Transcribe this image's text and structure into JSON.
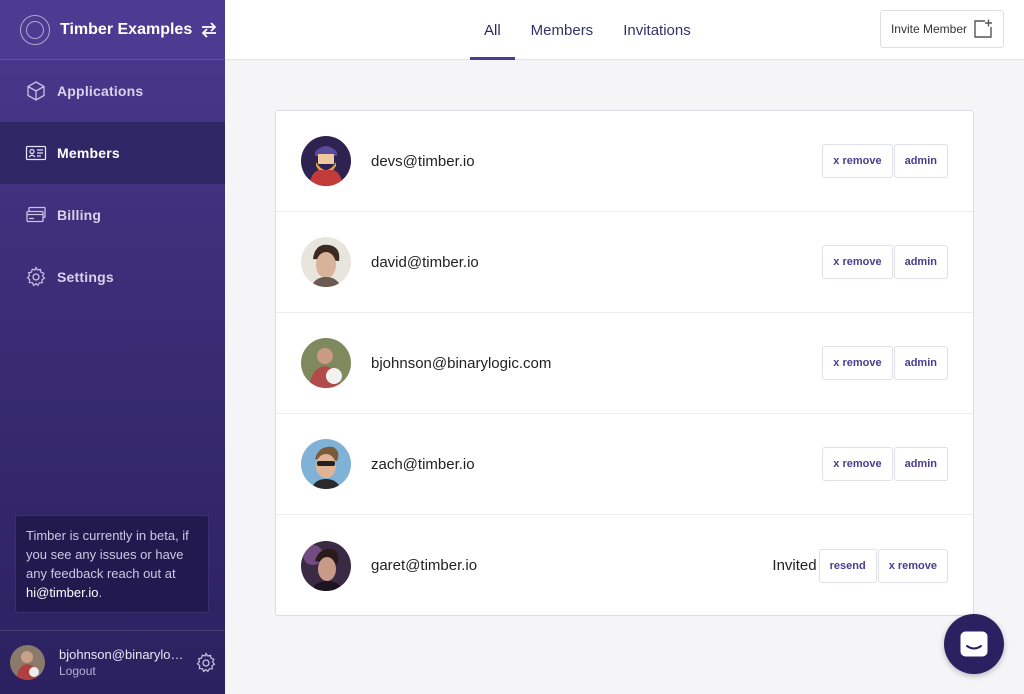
{
  "app": {
    "title": "Timber Examples"
  },
  "sidebar": {
    "items": [
      {
        "label": "Applications",
        "icon": "cube-icon"
      },
      {
        "label": "Members",
        "icon": "id-card-icon",
        "active": true
      },
      {
        "label": "Billing",
        "icon": "credit-card-icon"
      },
      {
        "label": "Settings",
        "icon": "gear-icon"
      }
    ],
    "beta_text": "Timber is currently in beta, if you see any issues or have any feedback reach out at",
    "beta_email": "hi@timber.io",
    "beta_end": ".",
    "user_email": "bjohnson@binarylogic.com",
    "logout": "Logout"
  },
  "tabs": [
    {
      "label": "All",
      "active": true
    },
    {
      "label": "Members"
    },
    {
      "label": "Invitations"
    }
  ],
  "invite_button": "Invite Member",
  "members": [
    {
      "email": "devs@timber.io",
      "btn1": "x remove",
      "btn2": "admin",
      "status": ""
    },
    {
      "email": "david@timber.io",
      "btn1": "x remove",
      "btn2": "admin",
      "status": ""
    },
    {
      "email": "bjohnson@binarylogic.com",
      "btn1": "x remove",
      "btn2": "admin",
      "status": ""
    },
    {
      "email": "zach@timber.io",
      "btn1": "x remove",
      "btn2": "admin",
      "status": ""
    },
    {
      "email": "garet@timber.io",
      "btn1": "resend",
      "btn2": "x remove",
      "status": "Invited"
    }
  ],
  "colors": {
    "sidebar": "#3d2f7a",
    "accent": "#4b3c91",
    "chat": "#2b2160"
  }
}
